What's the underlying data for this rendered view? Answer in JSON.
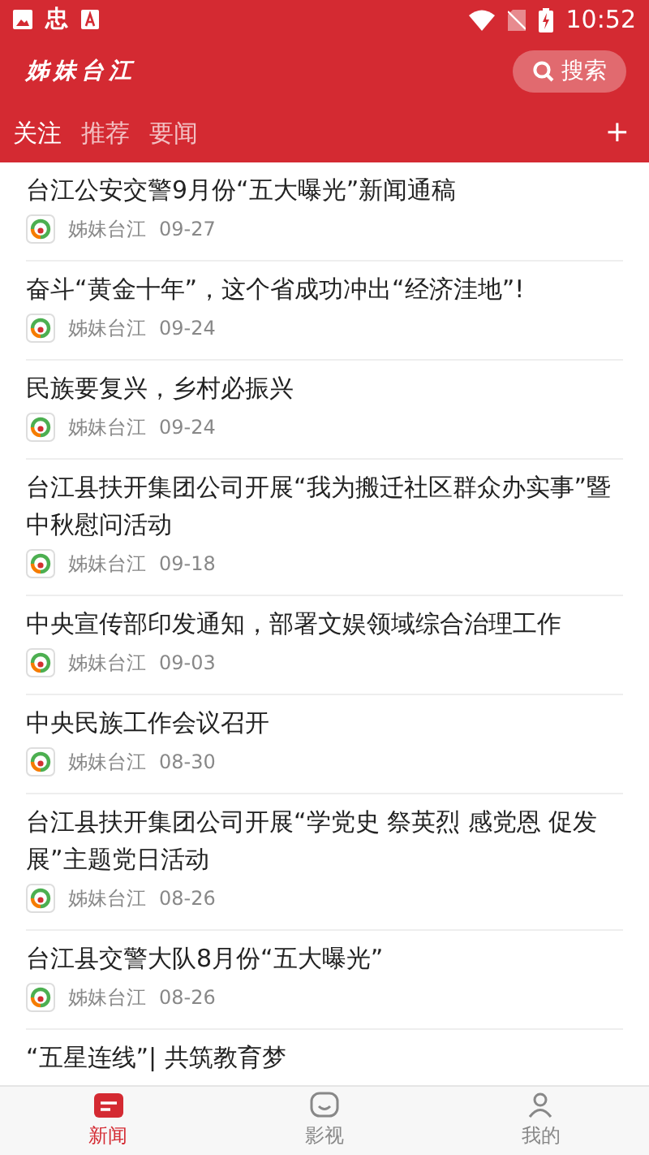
{
  "status_bar": {
    "notification_text": "忠",
    "time": "10:52"
  },
  "header": {
    "app_title": "姊妹台江",
    "search_label": "搜索"
  },
  "tabs": [
    {
      "label": "关注",
      "selected": true
    },
    {
      "label": "推荐",
      "selected": false
    },
    {
      "label": "要闻",
      "selected": false
    }
  ],
  "add_tab": "+",
  "news": [
    {
      "title": "台江公安交警9月份“五大曝光”新闻通稿",
      "source": "姊妹台江",
      "date": "09-27"
    },
    {
      "title": "奋斗“黄金十年”，这个省成功冲出“经济洼地”!",
      "source": "姊妹台江",
      "date": "09-24"
    },
    {
      "title": "民族要复兴，乡村必振兴",
      "source": "姊妹台江",
      "date": "09-24"
    },
    {
      "title": "台江县扶开集团公司开展“我为搬迁社区群众办实事”暨中秋慰问活动",
      "source": "姊妹台江",
      "date": "09-18"
    },
    {
      "title": "中央宣传部印发通知，部署文娱领域综合治理工作",
      "source": "姊妹台江",
      "date": "09-03"
    },
    {
      "title": "中央民族工作会议召开",
      "source": "姊妹台江",
      "date": "08-30"
    },
    {
      "title": "台江县扶开集团公司开展“学党史 祭英烈 感党恩 促发展”主题党日活动",
      "source": "姊妹台江",
      "date": "08-26"
    },
    {
      "title": "台江县交警大队8月份“五大曝光”",
      "source": "姊妹台江",
      "date": "08-26"
    },
    {
      "title": "“五星连线”| 共筑教育梦"
    }
  ],
  "bottom_nav": [
    {
      "label": "新闻",
      "kind": "news",
      "selected": true
    },
    {
      "label": "影视",
      "kind": "video",
      "selected": false
    },
    {
      "label": "我的",
      "kind": "me",
      "selected": false
    }
  ]
}
